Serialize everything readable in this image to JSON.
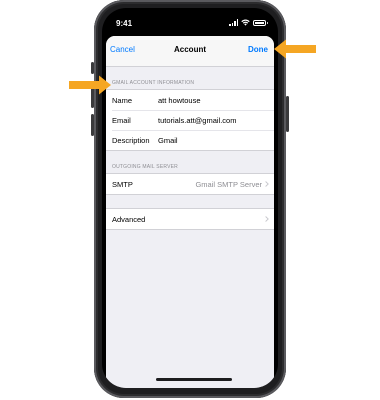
{
  "status_bar": {
    "time": "9:41",
    "icons": [
      "cellular-signal-icon",
      "wifi-icon",
      "battery-icon"
    ],
    "battery_level": 1.0
  },
  "nav": {
    "cancel": "Cancel",
    "title": "Account",
    "done": "Done"
  },
  "gmail_section": {
    "header": "GMAIL ACCOUNT INFORMATION",
    "rows": [
      {
        "label": "Name",
        "value": "att howtouse"
      },
      {
        "label": "Email",
        "value": "tutorials.att@gmail.com"
      },
      {
        "label": "Description",
        "value": "Gmail"
      }
    ]
  },
  "smtp_section": {
    "header": "OUTGOING MAIL SERVER",
    "label": "SMTP",
    "value": "Gmail SMTP Server"
  },
  "advanced": {
    "label": "Advanced"
  },
  "colors": {
    "accent": "#007aff",
    "callout_arrow": "#f5a623",
    "group_background": "#efeff4",
    "secondary_text": "#8e8e93"
  },
  "callouts": [
    "arrow-pointing-left-at-done",
    "arrow-pointing-right-at-name"
  ]
}
